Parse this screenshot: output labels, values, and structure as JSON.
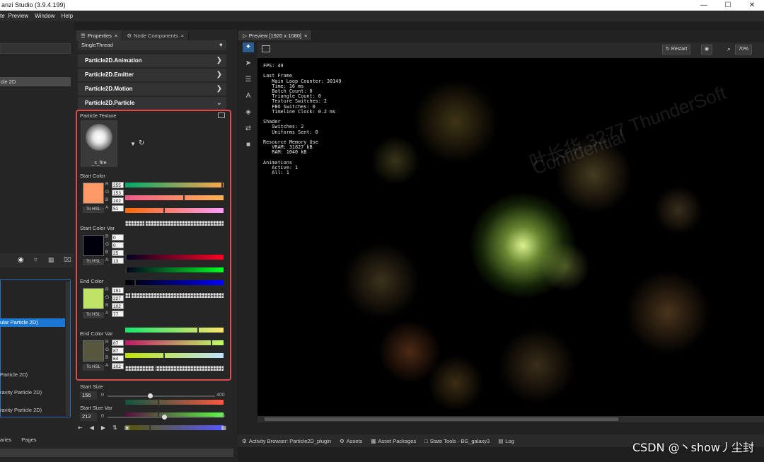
{
  "app": {
    "title": "anzi Studio (3.9.4.199)"
  },
  "menu": [
    "te",
    "Preview",
    "Window",
    "Help"
  ],
  "left": {
    "selected_item": "cle 2D",
    "highlight_item": "ular Particle 2D)",
    "items": [
      "Particle 2D)",
      "ravity Particle 2D)",
      "ravity Particle 2D)"
    ],
    "bottom_tabs": [
      "aries",
      "Pages"
    ]
  },
  "properties": {
    "tabs": [
      "Properties",
      "Node Components"
    ],
    "thread_value": "SingleThread",
    "sections": [
      "Particle2D.Animation",
      "Particle2D.Emitter",
      "Particle2D.Motion",
      "Particle2D.Particle"
    ],
    "texture": {
      "label": "Particle Texture",
      "name": "_s_fire"
    },
    "colors": [
      {
        "label": "Start Color",
        "swatch": "#ff9966",
        "to_hsl": "To HSL",
        "r": "255",
        "g": "153",
        "b": "102",
        "a": "51"
      },
      {
        "label": "Start Color Var",
        "swatch": "#00000d",
        "to_hsl": "To HSL",
        "r": "0",
        "g": "0",
        "b": "25",
        "a": "13"
      },
      {
        "label": "End Color",
        "swatch": "#bfe366",
        "to_hsl": "To HSL",
        "r": "191",
        "g": "227",
        "b": "102",
        "a": "77"
      },
      {
        "label": "End Color Var",
        "swatch": "#575740",
        "to_hsl": "To HSL",
        "r": "87",
        "g": "87",
        "b": "64",
        "a": "102"
      }
    ],
    "channel_letters": [
      "R",
      "G",
      "B",
      "A"
    ],
    "start_size": {
      "label": "Start Size",
      "value": "156",
      "min": "0",
      "max": "400",
      "fraction": 0.39
    },
    "start_size_var": {
      "label": "Start Size Var",
      "value": "212",
      "min": "0",
      "max": "400",
      "fraction": 0.53
    }
  },
  "preview": {
    "tab": "Preview [1920 x 1080]",
    "restart_label": "Restart",
    "zoom": "70%",
    "stats": "FPS: 49\n\nLast Frame\n   Main Loop Counter: 30149\n   Time: 16 ms\n   Batch Count: 0\n   Triangle Count: 0\n   Texture Switches: 2\n   FBO Switches: 0\n   Timeline Clock: 0.2 ms\n\nShader\n   Switches: 2\n   Uniforms Sent: 0\n\nResource Memory Use\n   VRAM: 31827 kB\n   RAM: 1040 kB\n\nAnimations\n   Active: 1\n   All: 1"
  },
  "bottom_tabs": [
    "Activity Browser: Particle2D_plugin",
    "Assets",
    "Asset Packages",
    "State Tools - BG_galaxy3",
    "Log"
  ],
  "overlay": {
    "watermark": "CSDN @丶show丿尘封",
    "faint_1": "叶长华 3277 ThunderSoft",
    "faint_2": "Confidential"
  }
}
